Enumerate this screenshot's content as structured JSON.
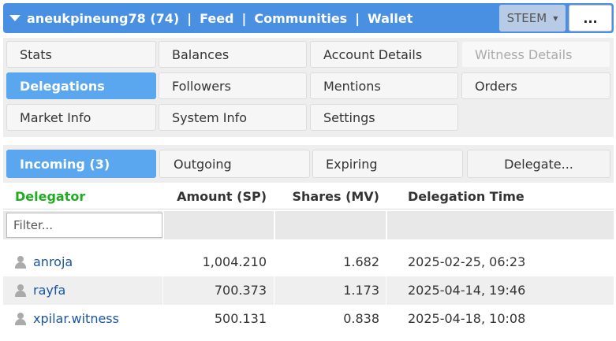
{
  "header": {
    "username": "aneukpineung78",
    "reputation": "(74)",
    "nav": [
      "Feed",
      "Communities",
      "Wallet"
    ],
    "separator": "|",
    "token_selected": "STEEM",
    "more_label": "..."
  },
  "menu": {
    "items": [
      {
        "label": "Stats",
        "state": "normal"
      },
      {
        "label": "Balances",
        "state": "normal"
      },
      {
        "label": "Account Details",
        "state": "normal"
      },
      {
        "label": "Witness Details",
        "state": "disabled"
      },
      {
        "label": "Delegations",
        "state": "active"
      },
      {
        "label": "Followers",
        "state": "normal"
      },
      {
        "label": "Mentions",
        "state": "normal"
      },
      {
        "label": "Orders",
        "state": "normal"
      },
      {
        "label": "Market Info",
        "state": "normal"
      },
      {
        "label": "System Info",
        "state": "normal"
      },
      {
        "label": "Settings",
        "state": "normal"
      }
    ]
  },
  "tabs": {
    "incoming": "Incoming (3)",
    "outgoing": "Outgoing",
    "expiring": "Expiring",
    "delegate": "Delegate..."
  },
  "table": {
    "columns": [
      "Delegator",
      "Amount (SP)",
      "Shares (MV)",
      "Delegation Time"
    ],
    "filter_placeholder": "Filter...",
    "rows": [
      {
        "delegator": "anroja",
        "amount": "1,004.210",
        "shares": "1.682",
        "time": "2025-02-25, 06:23"
      },
      {
        "delegator": "rayfa",
        "amount": "700.373",
        "shares": "1.173",
        "time": "2025-04-14, 19:46"
      },
      {
        "delegator": "xpilar.witness",
        "amount": "500.131",
        "shares": "0.838",
        "time": "2025-04-18, 10:08"
      }
    ]
  },
  "colors": {
    "topbar": "#4a90e2",
    "active": "#5aa7f0",
    "delegator_header": "#22aa22",
    "link": "#1a55a5"
  },
  "icons": {
    "user": "user-icon",
    "dropdown": "caret-down-icon"
  }
}
